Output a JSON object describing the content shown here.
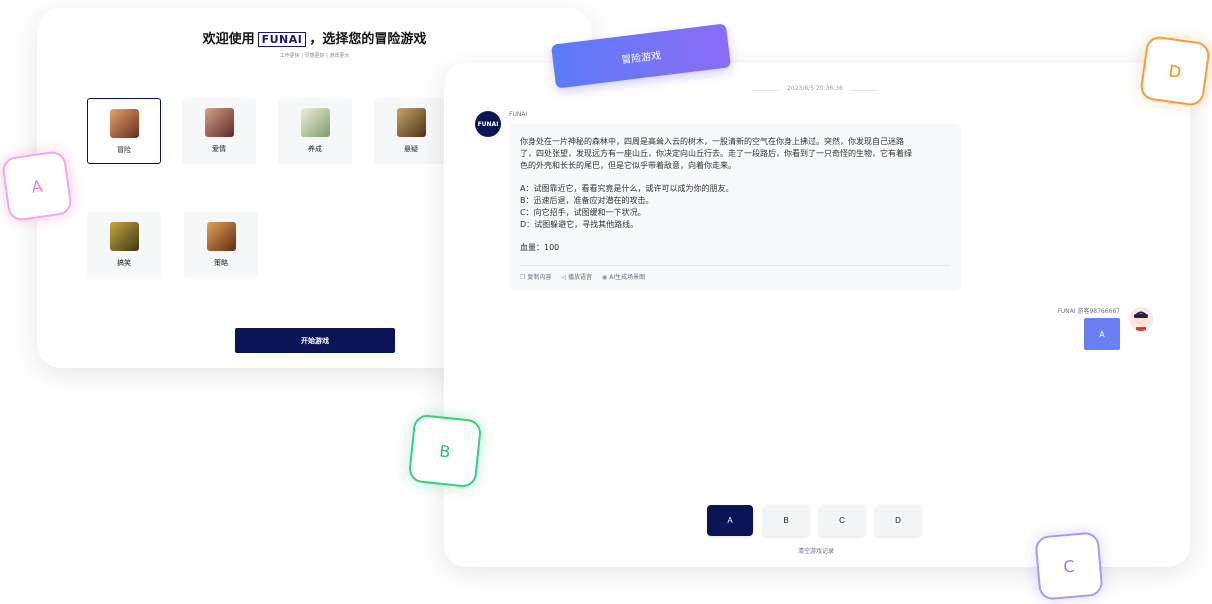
{
  "welcome": {
    "title_prefix": "欢迎使用",
    "brand": "FUNAI",
    "title_suffix": "，选择您的冒险游戏",
    "subtitle": "工作更快 | 灵感更好 | 游戏更大"
  },
  "genres": [
    {
      "label": "冒险",
      "selected": true,
      "color": "#b55b3c"
    },
    {
      "label": "爱情",
      "selected": false,
      "color": "#9d5a4a"
    },
    {
      "label": "养成",
      "selected": false,
      "color": "#8aa274"
    },
    {
      "label": "悬疑",
      "selected": false,
      "color": "#8a6a3a"
    },
    {
      "label": "搞笑",
      "selected": false,
      "color": "#7c7a2a"
    },
    {
      "label": "策略",
      "selected": false,
      "color": "#b06a3a"
    }
  ],
  "start_button": "开始游戏",
  "tag_label": "冒险游戏",
  "chat": {
    "timestamp": "2023/6/5 20:36:36",
    "ai_avatar": "FUNAI",
    "ai_name": "FUNAI",
    "message_lines": [
      "你身处在一片神秘的森林中，四周是高耸入云的树木，一股清新的空气在你身上拂过。突然，你发现自己迷路",
      "了，四处张望，发现远方有一座山丘，你决定向山丘行去。走了一段路后，你看到了一只奇怪的生物，它有着绿",
      "色的外壳和长长的尾巴，但是它似乎带着敌意，向着你走来。"
    ],
    "options_lines": [
      "A：试图靠近它，看看究竟是什么，或许可以成为你的朋友。",
      "B：迅速后退，准备应对潜在的攻击。",
      "C：向它招手，试图缓和一下状况。",
      "D：试图躲避它，寻找其他路线。"
    ],
    "hp": "血量：100",
    "actions": [
      {
        "icon": "copy-icon",
        "label": "复制内容"
      },
      {
        "icon": "speaker-icon",
        "label": "播放语音"
      },
      {
        "icon": "eye-icon",
        "label": "AI生成场景图"
      }
    ],
    "user_name": "FUNAI 游客98766667",
    "user_reply": "A"
  },
  "choices": [
    "A",
    "B",
    "C",
    "D"
  ],
  "active_choice": "A",
  "clear_label": "清空游戏记录",
  "floats": {
    "a": "A",
    "b": "B",
    "c": "C",
    "d": "D"
  }
}
